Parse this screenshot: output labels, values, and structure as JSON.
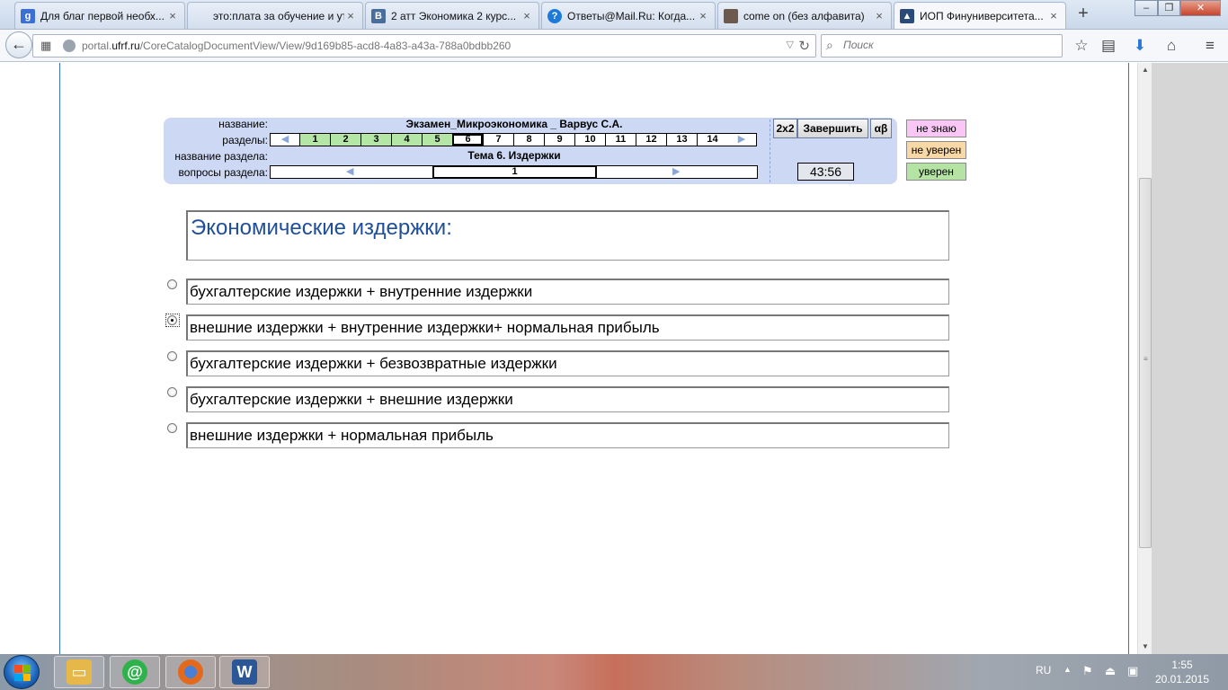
{
  "browser": {
    "tabs": [
      {
        "title": "Для благ первой необх...",
        "favicon": "google-g",
        "color": "#3b6fd6"
      },
      {
        "title": "это:плата за обучение и ут...",
        "favicon": "blank",
        "color": ""
      },
      {
        "title": "2 атт Экономика 2 курс...",
        "favicon": "vk-b",
        "color": "#4a6e9c"
      },
      {
        "title": "Ответы@Mail.Ru: Когда...",
        "favicon": "question-mark",
        "color": "#1c7bd8"
      },
      {
        "title": "come on (без алфавита)",
        "favicon": "photo",
        "color": "#6b5a4d"
      },
      {
        "title": "ИОП Финуниверситета...",
        "favicon": "mortarboard",
        "color": "#2a4a7a"
      }
    ],
    "url_prefix": "portal.",
    "url_domain": "ufrf.ru",
    "url_path": "/CoreCatalogDocumentView/View/9d169b85-acd8-4a83-a43a-788a0bdbb260",
    "search_placeholder": "Поиск"
  },
  "test": {
    "labels": {
      "name": "название:",
      "sections": "разделы:",
      "section_name": "название раздела:",
      "section_questions": "вопросы раздела:"
    },
    "exam_title": "Экзамен_Микроэкономика _ Варвус С.А.",
    "sections": [
      {
        "num": "1",
        "state": "done"
      },
      {
        "num": "2",
        "state": "done"
      },
      {
        "num": "3",
        "state": "done"
      },
      {
        "num": "4",
        "state": "done"
      },
      {
        "num": "5",
        "state": "done"
      },
      {
        "num": "6",
        "state": "current"
      },
      {
        "num": "7",
        "state": "todo"
      },
      {
        "num": "8",
        "state": "todo"
      },
      {
        "num": "9",
        "state": "todo"
      },
      {
        "num": "10",
        "state": "todo"
      },
      {
        "num": "11",
        "state": "todo"
      },
      {
        "num": "12",
        "state": "todo"
      },
      {
        "num": "13",
        "state": "todo"
      },
      {
        "num": "14",
        "state": "todo"
      }
    ],
    "section_title": "Тема 6. Издержки",
    "current_question": "1",
    "buttons": {
      "layout": "2x2",
      "finish": "Завершить",
      "greek": "αβ"
    },
    "timer": "43:56",
    "confidence": {
      "dont_know": "не знаю",
      "not_sure": "не уверен",
      "sure": "уверен",
      "colors": {
        "dont_know": "#f9c6f5",
        "not_sure": "#f8d8a6",
        "sure": "#b4e3a4"
      }
    }
  },
  "question": {
    "text": "Экономические издержки:",
    "selected_index": 1,
    "answers": [
      "бухгалтерские издержки + внутренние издержки",
      "внешние издержки + внутренние издержки+ нормальная прибыль",
      "бухгалтерские издержки + безвозвратные издержки",
      "бухгалтерские издержки + внешние издержки",
      "внешние издержки + нормальная прибыль"
    ]
  },
  "taskbar": {
    "apps": [
      {
        "name": "explorer",
        "color": "#e6b84a"
      },
      {
        "name": "mail-agent",
        "color": "#2fb24b"
      },
      {
        "name": "firefox",
        "color": "#e36a1c"
      },
      {
        "name": "word",
        "color": "#2b5797",
        "letter": "W"
      }
    ],
    "language": "RU",
    "time": "1:55",
    "date": "20.01.2015"
  }
}
